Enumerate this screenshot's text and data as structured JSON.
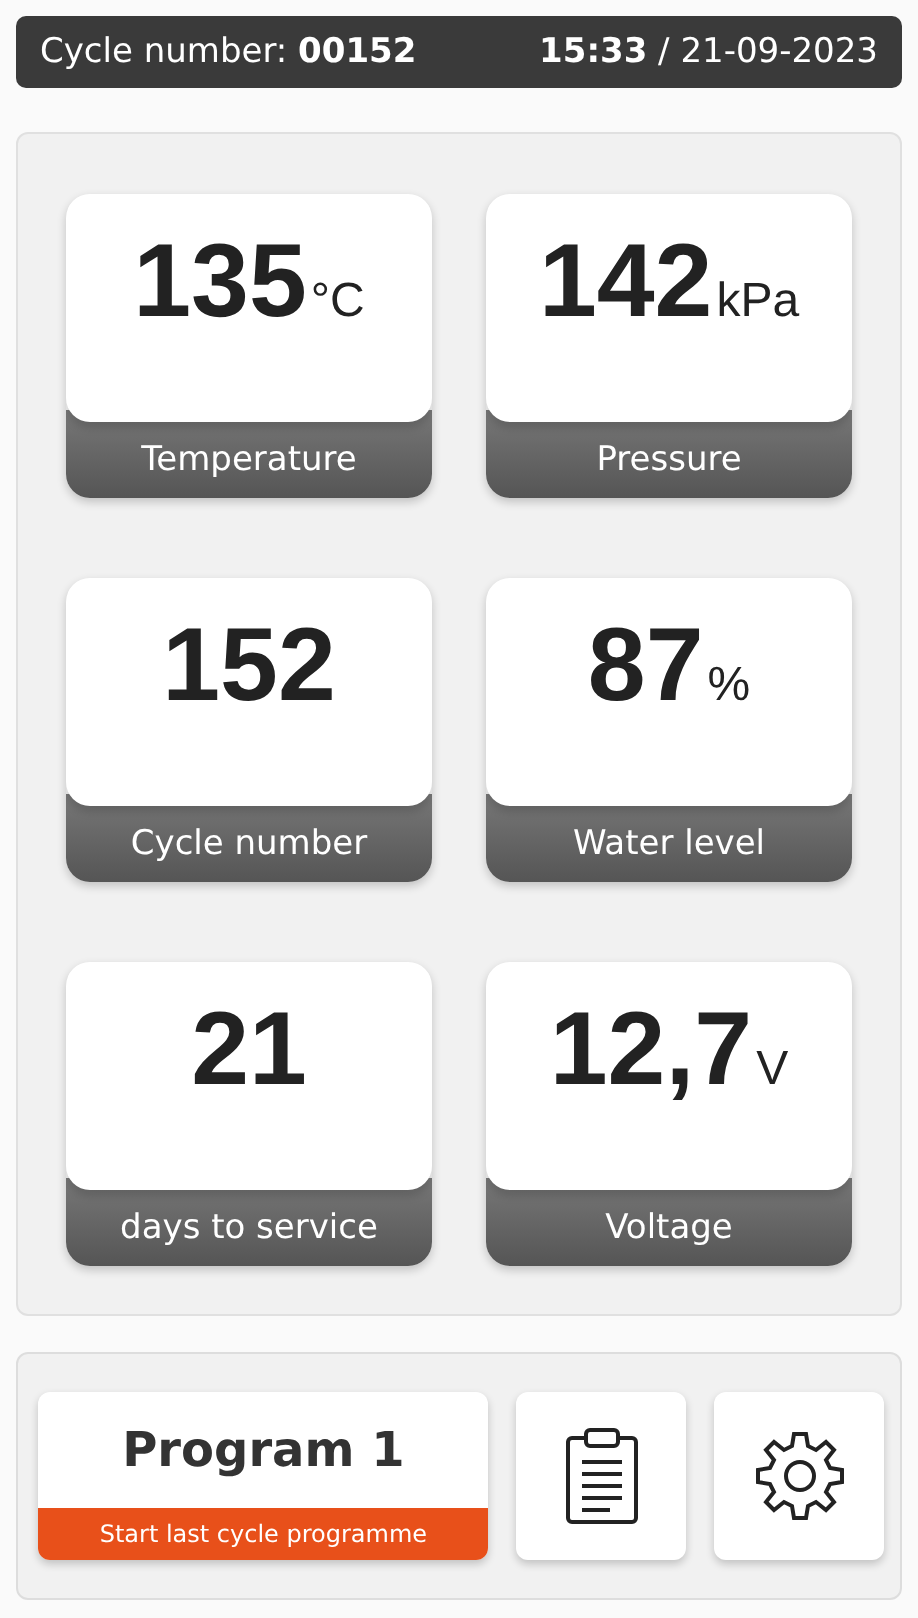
{
  "header": {
    "label": "Cycle number:",
    "cycle": "00152",
    "time": "15:33",
    "date": "/ 21-09-2023"
  },
  "tiles": [
    {
      "value": "135",
      "unit": "°C",
      "label": "Temperature"
    },
    {
      "value": "142",
      "unit": "kPa",
      "label": "Pressure"
    },
    {
      "value": "152",
      "label": "Cycle number"
    },
    {
      "value": "87",
      "unit": "%",
      "label": "Water level"
    },
    {
      "value": "21",
      "label": "days to service"
    },
    {
      "value": "12,7",
      "unit": "V",
      "label": "Voltage"
    }
  ],
  "program": {
    "title": "Program 1",
    "subtitle": "Start last cycle programme"
  }
}
